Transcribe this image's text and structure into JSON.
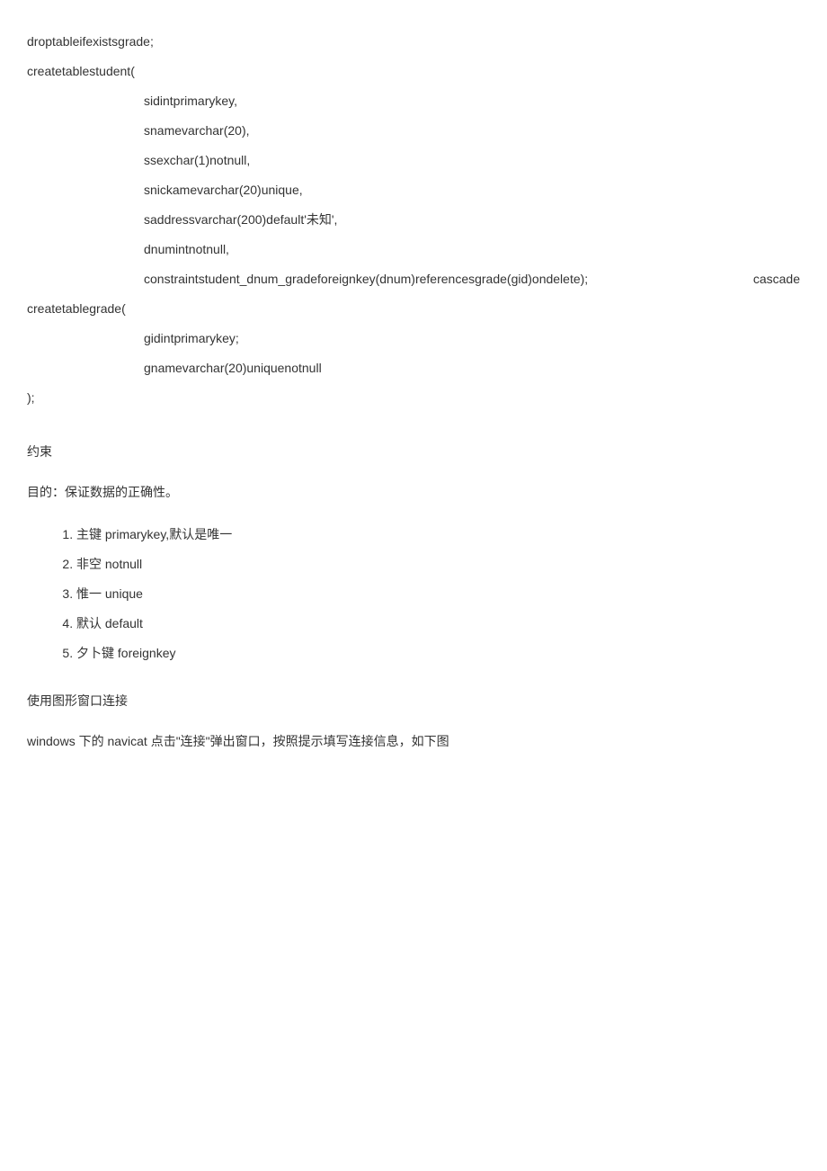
{
  "code": {
    "line1": "droptableifexistsgrade;",
    "line2": "createtablestudent(",
    "line3": "sidintprimarykey,",
    "line4": "snamevarchar(20),",
    "line5": "ssexchar(1)notnull,",
    "line6": "snickamevarchar(20)unique,",
    "line7": "saddressvarchar(200)default'未知',",
    "line8": "dnumintnotnull,",
    "line9_left": "constraintstudent_dnum_gradeforeignkey(dnum)referencesgrade(gid)ondelete);",
    "line9_right": "cascade",
    "line10": "createtablegrade(",
    "line11": "gidintprimarykey;",
    "line12": "gnamevarchar(20)uniquenotnull",
    "line13": ");"
  },
  "sections": {
    "constraints_heading": "约束",
    "constraints_purpose": "目的：保证数据的正确性。",
    "constraints_list": [
      "主键 primarykey,默认是唯一",
      "非空 notnull",
      "惟一 unique",
      "默认 default",
      "夕卜键 foreignkey"
    ],
    "gui_heading": "使用图形窗口连接",
    "gui_paragraph": "windows 下的 navicat 点击\"连接\"弹出窗口，按照提示填写连接信息，如下图"
  }
}
